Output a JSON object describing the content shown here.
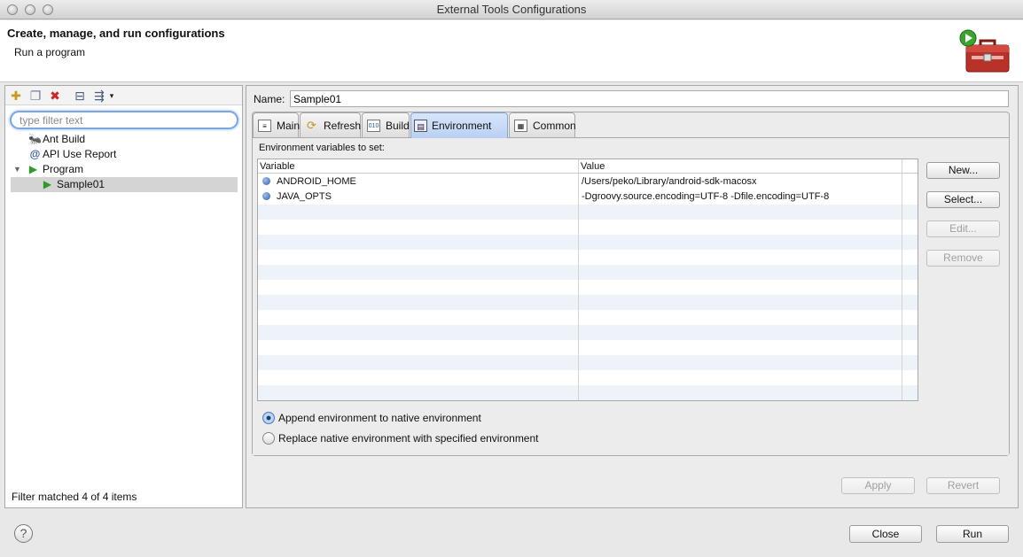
{
  "window": {
    "title": "External Tools Configurations"
  },
  "header": {
    "title": "Create, manage, and run configurations",
    "subtitle": "Run a program"
  },
  "left": {
    "filter_placeholder": "type filter text",
    "tree": [
      {
        "label": "Ant Build"
      },
      {
        "label": "API Use Report"
      },
      {
        "label": "Program"
      },
      {
        "label": "Sample01"
      }
    ],
    "status": "Filter matched 4 of 4 items"
  },
  "right": {
    "name_label": "Name:",
    "name_value": "Sample01",
    "tabs": [
      {
        "label": "Main"
      },
      {
        "label": "Refresh"
      },
      {
        "label": "Build"
      },
      {
        "label": "Environment"
      },
      {
        "label": "Common"
      }
    ],
    "env_label": "Environment variables to set:",
    "table": {
      "headers": [
        "Variable",
        "Value"
      ],
      "rows": [
        {
          "variable": "ANDROID_HOME",
          "value": "/Users/peko/Library/android-sdk-macosx"
        },
        {
          "variable": "JAVA_OPTS",
          "value": "-Dgroovy.source.encoding=UTF-8 -Dfile.encoding=UTF-8"
        }
      ]
    },
    "buttons": {
      "new": "New...",
      "select": "Select...",
      "edit": "Edit...",
      "remove": "Remove"
    },
    "radios": {
      "append": "Append environment to native environment",
      "replace": "Replace native environment with specified environment"
    },
    "apply": "Apply",
    "revert": "Revert"
  },
  "footer": {
    "close": "Close",
    "run": "Run"
  }
}
